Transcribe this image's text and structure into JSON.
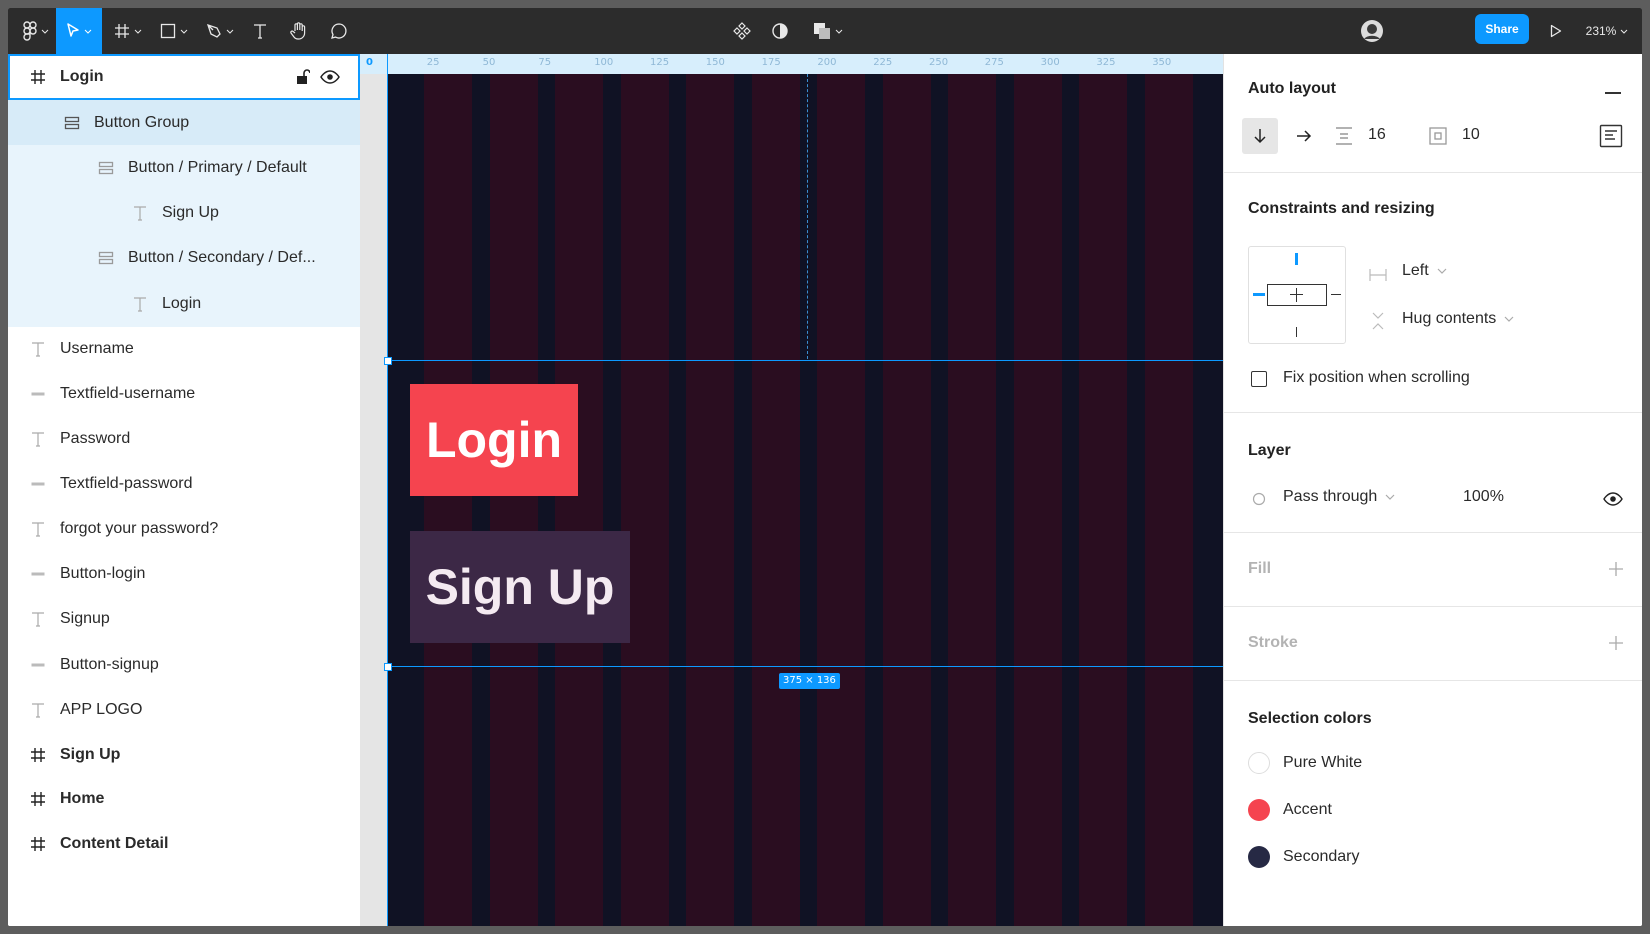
{
  "toolbar": {
    "share_label": "Share",
    "zoom": "231%",
    "icons": [
      "figma-menu-icon",
      "move-tool-icon",
      "frame-tool-icon",
      "shape-tool-icon",
      "pen-tool-icon",
      "text-tool-icon",
      "hand-tool-icon",
      "comment-tool-icon",
      "component-icon",
      "mask-icon",
      "boolean-icon",
      "avatar",
      "play-icon"
    ],
    "accent": "#0d99ff"
  },
  "layers": {
    "items": [
      {
        "label": "Login",
        "type": "frame",
        "bold": true
      },
      {
        "label": "Button Group",
        "type": "autolayout"
      },
      {
        "label": "Button / Primary / Default",
        "type": "autolayout"
      },
      {
        "label": "Sign Up",
        "type": "text"
      },
      {
        "label": "Button / Secondary / Def...",
        "type": "autolayout"
      },
      {
        "label": "Login",
        "type": "text"
      },
      {
        "label": "Username",
        "type": "text"
      },
      {
        "label": "Textfield-username",
        "type": "rect"
      },
      {
        "label": "Password",
        "type": "text"
      },
      {
        "label": "Textfield-password",
        "type": "rect"
      },
      {
        "label": "forgot your password?",
        "type": "text"
      },
      {
        "label": "Button-login",
        "type": "rect"
      },
      {
        "label": "Signup",
        "type": "text"
      },
      {
        "label": "Button-signup",
        "type": "rect"
      },
      {
        "label": "APP LOGO",
        "type": "text"
      },
      {
        "label": "Sign Up",
        "type": "frame",
        "bold": true
      },
      {
        "label": "Home",
        "type": "frame",
        "bold": true
      },
      {
        "label": "Content Detail",
        "type": "frame",
        "bold": true
      }
    ]
  },
  "canvas": {
    "ruler_ticks": [
      "0",
      "25",
      "50",
      "75",
      "100",
      "125",
      "150",
      "175",
      "200",
      "225",
      "250",
      "275",
      "300",
      "325",
      "350"
    ],
    "login_button_text": "Login",
    "signup_button_text": "Sign Up",
    "selection_size": "375 × 136",
    "colors": {
      "frame_bg": "#101224",
      "column": "#2a0d20",
      "primary": "#f5444f",
      "secondary": "#3c2846"
    }
  },
  "props": {
    "auto_layout": {
      "title": "Auto layout",
      "spacing": "16",
      "padding": "10"
    },
    "constraints": {
      "title": "Constraints and resizing",
      "horizontal": "Left",
      "vertical": "Hug contents",
      "fix_position": "Fix position when scrolling"
    },
    "layer": {
      "title": "Layer",
      "blend": "Pass through",
      "opacity": "100%"
    },
    "fill": {
      "title": "Fill"
    },
    "stroke": {
      "title": "Stroke"
    },
    "selection_colors": {
      "title": "Selection colors",
      "items": [
        {
          "name": "Pure White",
          "color": "#ffffff"
        },
        {
          "name": "Accent",
          "color": "#f5444f"
        },
        {
          "name": "Secondary",
          "color": "#262944"
        }
      ]
    }
  }
}
